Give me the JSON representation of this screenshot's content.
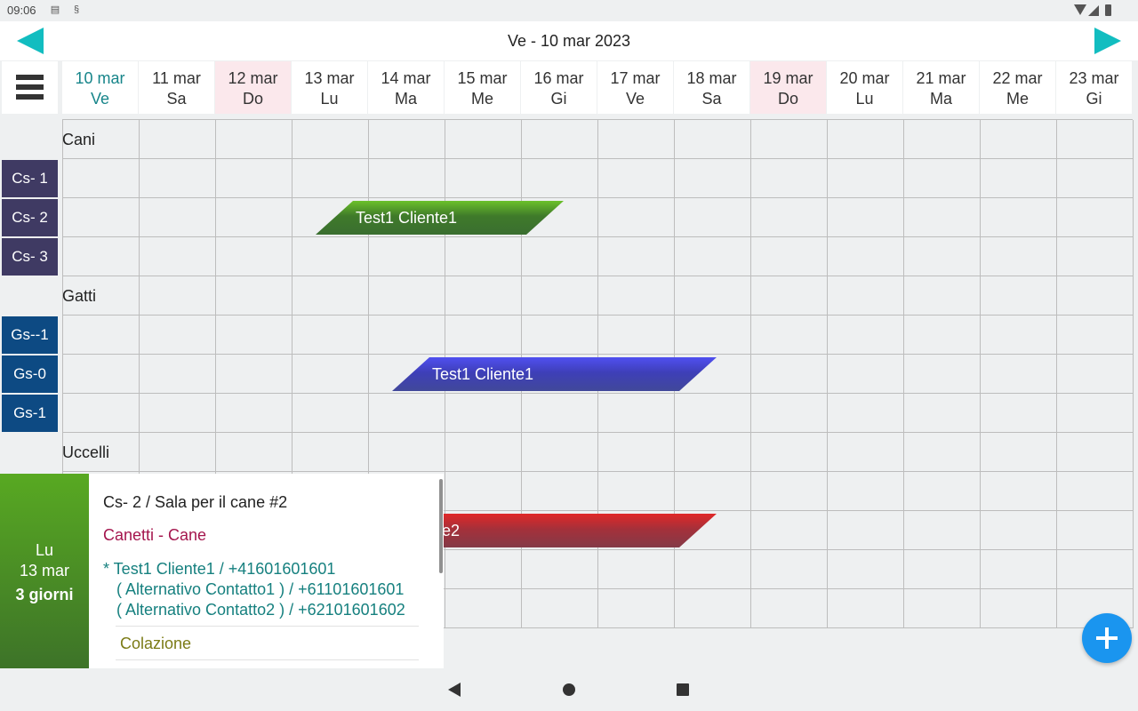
{
  "status_bar": {
    "time": "09:06",
    "icons": [
      "message-icon",
      "sync-icon",
      "wifi-icon",
      "signal-icon",
      "battery-icon"
    ]
  },
  "header": {
    "title": "Ve - 10 mar 2023",
    "prev_icon": "arrow-left-icon",
    "next_icon": "arrow-right-icon"
  },
  "menu": {
    "icon": "hamburger-menu-icon"
  },
  "dates": [
    {
      "date": "10 mar",
      "day": "Ve"
    },
    {
      "date": "11 mar",
      "day": "Sa"
    },
    {
      "date": "12 mar",
      "day": "Do"
    },
    {
      "date": "13 mar",
      "day": "Lu"
    },
    {
      "date": "14 mar",
      "day": "Ma"
    },
    {
      "date": "15 mar",
      "day": "Me"
    },
    {
      "date": "16 mar",
      "day": "Gi"
    },
    {
      "date": "17 mar",
      "day": "Ve"
    },
    {
      "date": "18 mar",
      "day": "Sa"
    },
    {
      "date": "19 mar",
      "day": "Do"
    },
    {
      "date": "20 mar",
      "day": "Lu"
    },
    {
      "date": "21 mar",
      "day": "Ma"
    },
    {
      "date": "22 mar",
      "day": "Me"
    },
    {
      "date": "23 mar",
      "day": "Gi"
    }
  ],
  "groups": [
    {
      "name": "Cani",
      "rooms": [
        "Cs- 1",
        "Cs- 2",
        "Cs- 3"
      ]
    },
    {
      "name": "Gatti",
      "rooms": [
        "Gs--1",
        "Gs-0",
        "Gs-1"
      ]
    },
    {
      "name": "Uccelli",
      "rooms": []
    }
  ],
  "bookings": [
    {
      "label": "Test1 Cliente1",
      "room": "Cs- 2",
      "start": "13 mar",
      "end": "16 mar",
      "color": "#3f7a2a"
    },
    {
      "label": "Test1 Cliente1",
      "room": "Gs-0",
      "start": "14 mar",
      "end": "18 mar",
      "color": "#3e3fb8"
    },
    {
      "label": "e2",
      "room": "",
      "start": "14 mar",
      "end": "18 mar",
      "color": "#8a3440"
    }
  ],
  "popup": {
    "day": "Lu",
    "date": "13 mar",
    "duration": "3 giorni",
    "room_line": "Cs- 2  /  Sala per il cane #2",
    "type_line": "Canetti - Cane",
    "contacts": [
      "*  Test1 Cliente1 / +41601601601",
      "( Alternativo Contatto1 ) / +61101601601",
      "( Alternativo Contatto2 ) / +62101601602"
    ],
    "service": "Colazione"
  },
  "fab": {
    "icon": "plus-icon"
  },
  "nav": {
    "back_icon": "back-icon",
    "home_icon": "home-icon",
    "recent_icon": "recent-apps-icon"
  }
}
